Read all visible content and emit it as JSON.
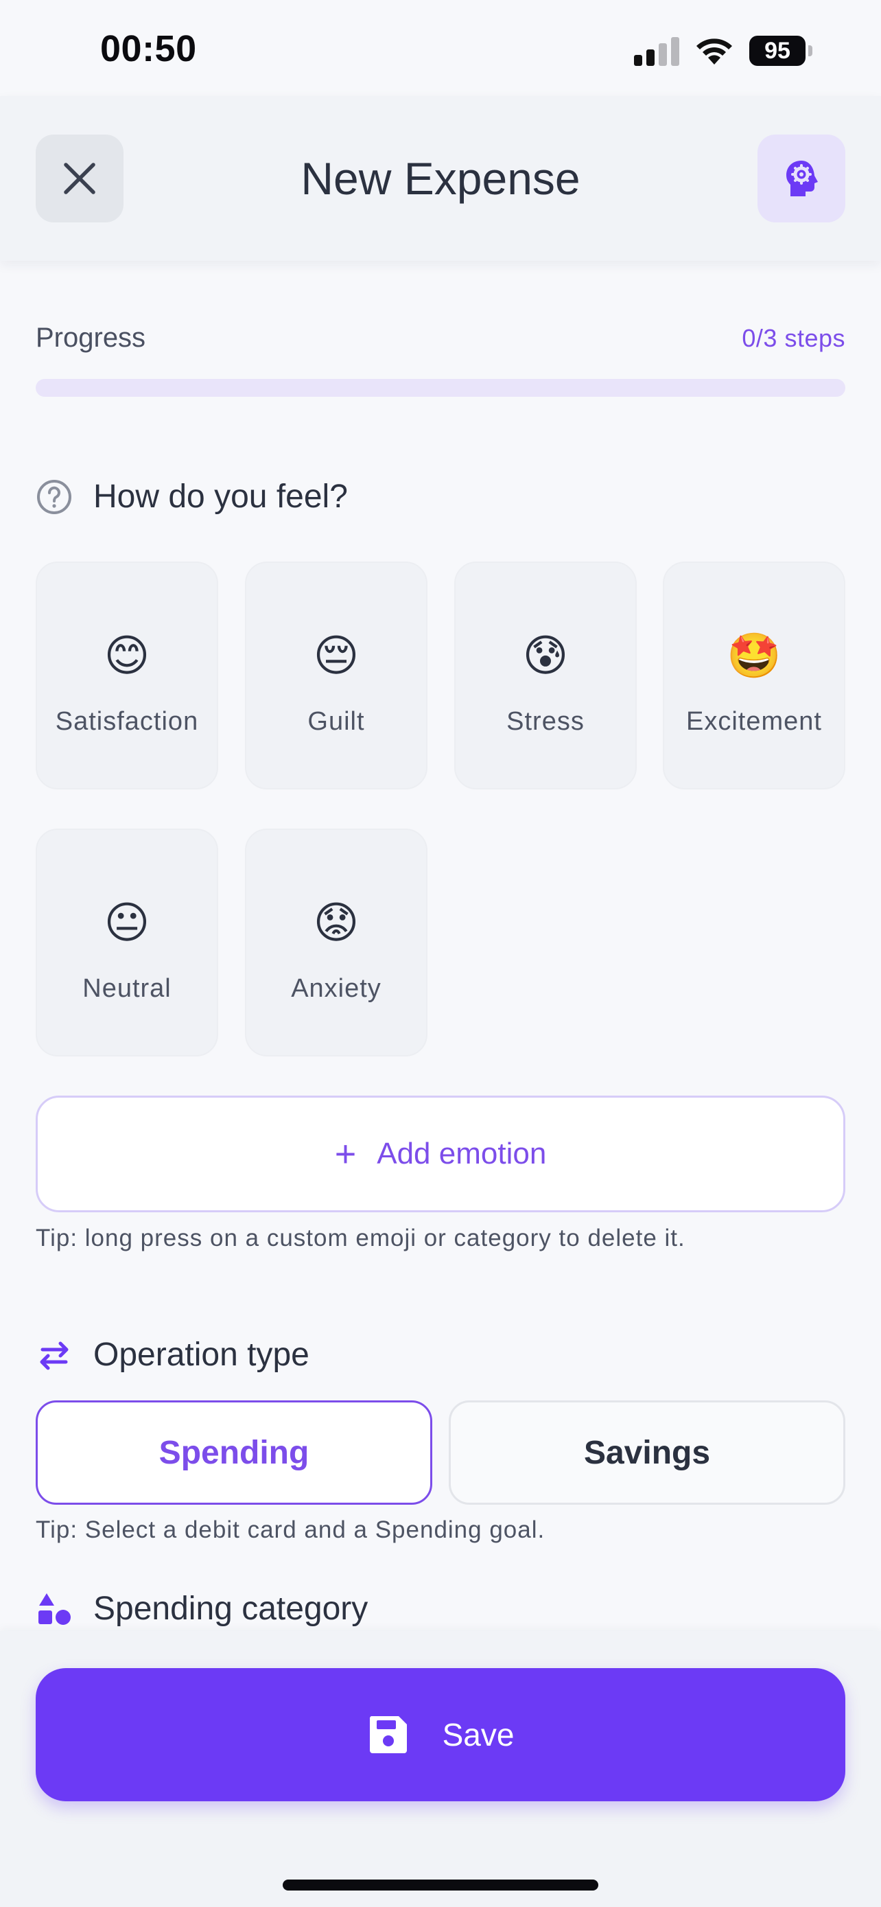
{
  "status_bar": {
    "time": "00:50",
    "battery": "95"
  },
  "header": {
    "title": "New Expense"
  },
  "progress": {
    "label": "Progress",
    "steps": "0/3 steps",
    "fraction": 0
  },
  "feel": {
    "title": "How do you feel?",
    "emotions": [
      {
        "emoji": "😊",
        "label": "Satisfaction"
      },
      {
        "emoji": "😔",
        "label": "Guilt"
      },
      {
        "emoji": "😰",
        "label": "Stress"
      },
      {
        "emoji": "🤩",
        "label": "Excitement"
      },
      {
        "emoji": "😐",
        "label": "Neutral"
      },
      {
        "emoji": "😟",
        "label": "Anxiety"
      }
    ],
    "add_label": "Add emotion",
    "tip": "Tip: long press on a custom emoji or category to delete it."
  },
  "operation": {
    "title": "Operation type",
    "options": [
      "Spending",
      "Savings"
    ],
    "selected": "Spending",
    "tip": "Tip: Select a debit card and a Spending goal."
  },
  "category": {
    "title": "Spending category"
  },
  "footer": {
    "save_label": "Save"
  },
  "colors": {
    "accent": "#6C3AF5",
    "accent_text": "#7C4DEA",
    "track": "#E9E4FA"
  }
}
